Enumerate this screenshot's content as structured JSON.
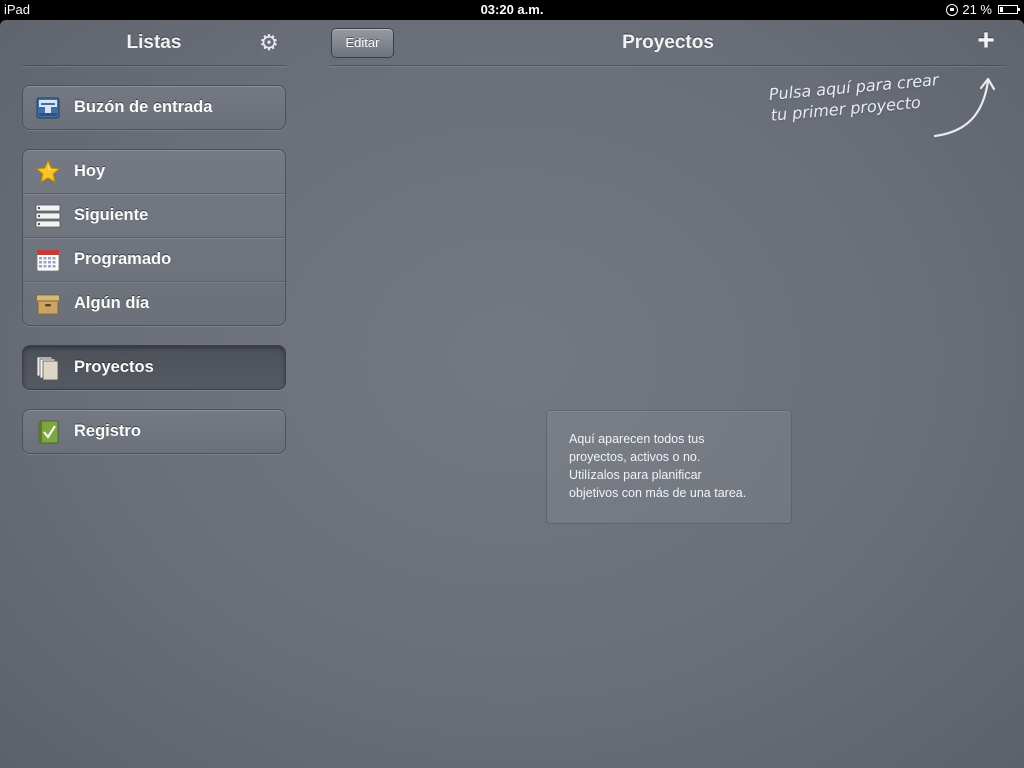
{
  "statusbar": {
    "device": "iPad",
    "time": "03:20 a.m.",
    "battery": "21 %",
    "battery_level": 0.21,
    "icons": [
      "rotation-lock-icon",
      "battery-icon"
    ]
  },
  "sidebar": {
    "title": "Listas",
    "settings_icon": "gear-icon",
    "groups": [
      {
        "items": [
          {
            "label": "Buzón de entrada",
            "icon": "inbox-icon"
          }
        ]
      },
      {
        "items": [
          {
            "label": "Hoy",
            "icon": "star-icon"
          },
          {
            "label": "Siguiente",
            "icon": "next-list-icon"
          },
          {
            "label": "Programado",
            "icon": "calendar-icon"
          },
          {
            "label": "Algún día",
            "icon": "box-icon"
          }
        ]
      },
      {
        "items": [
          {
            "label": "Proyectos",
            "icon": "projects-icon",
            "selected": true
          }
        ]
      },
      {
        "items": [
          {
            "label": "Registro",
            "icon": "logbook-icon"
          }
        ]
      }
    ]
  },
  "main": {
    "edit_label": "Editar",
    "title": "Proyectos",
    "add_icon": "plus-icon",
    "hint": {
      "line1": "Pulsa aquí para crear",
      "line2": "tu primer proyecto"
    },
    "info": {
      "line1": "Aquí aparecen todos tus",
      "line2": "proyectos, activos o no.",
      "line3": "Utilízalos para planificar",
      "line4": "objetivos con más de una tarea."
    }
  },
  "colors": {
    "background": "#6a6f79",
    "text": "#fbfbfc",
    "selected_row": "#4c5058"
  }
}
